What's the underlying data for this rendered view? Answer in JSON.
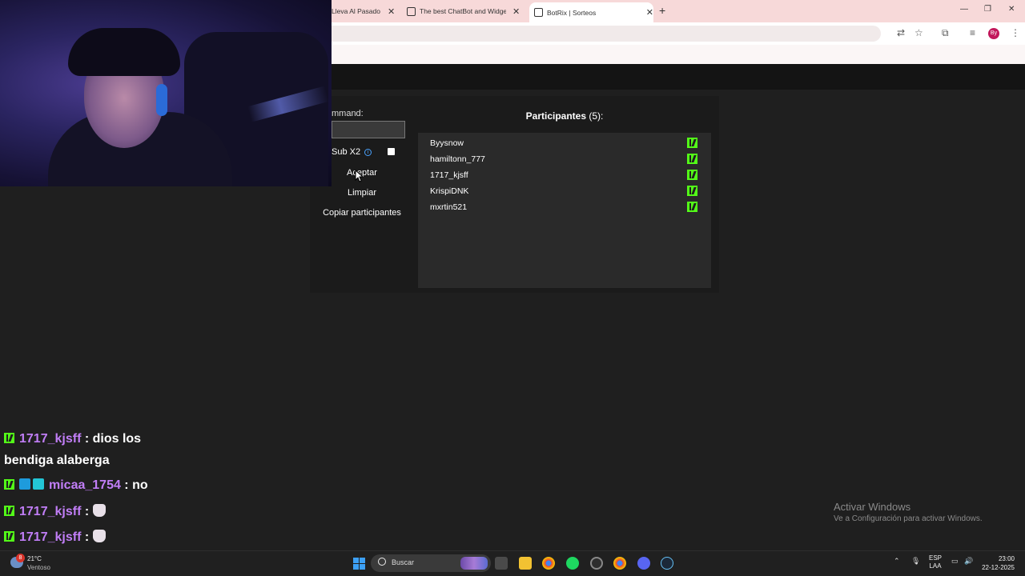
{
  "browser": {
    "tabs": [
      {
        "title": "Lleva Al Pasado C"
      },
      {
        "title": "The best ChatBot and Widgets"
      },
      {
        "title": "BotRix | Sorteos"
      }
    ],
    "profile_initials": "By"
  },
  "giveaway": {
    "command_label": "mmand:",
    "command_value": "",
    "sub_label": "Sub X2",
    "accept_button": "Aceptar",
    "clear_button": "Limpiar",
    "copy_button": "Copiar participantes",
    "participants_title": "Participantes",
    "participants_count": "(5):",
    "participants": [
      {
        "name": "Byysnow"
      },
      {
        "name": "hamiltonn_777"
      },
      {
        "name": "1717_kjsff"
      },
      {
        "name": "KrispiDNK"
      },
      {
        "name": "mxrtin521"
      }
    ]
  },
  "chat": {
    "messages": [
      {
        "user": "1717_kjsff",
        "sep": " : ",
        "text": "dios los",
        "cont": "bendiga alaberga"
      },
      {
        "user": "micaa_1754",
        "sep": " : ",
        "text": "no"
      },
      {
        "user": "1717_kjsff",
        "sep": " : ",
        "text": ""
      },
      {
        "user": "1717_kjsff",
        "sep": " : ",
        "text": ""
      }
    ]
  },
  "watermark": {
    "title": "Activar Windows",
    "subtitle": "Ve a Configuración para activar Windows."
  },
  "taskbar": {
    "weather_badge": "8",
    "temperature": "21°C",
    "weather_desc": "Ventoso",
    "search_placeholder": "Buscar",
    "lang_top": "ESP",
    "lang_bottom": "LAA",
    "time": "23:00",
    "date": "22-12-2025"
  },
  "colors": {
    "kick_green": "#53fc18",
    "chat_username": "#c17ef7",
    "panel_bg": "#1b1b1b",
    "list_bg": "#2a2a2a"
  }
}
